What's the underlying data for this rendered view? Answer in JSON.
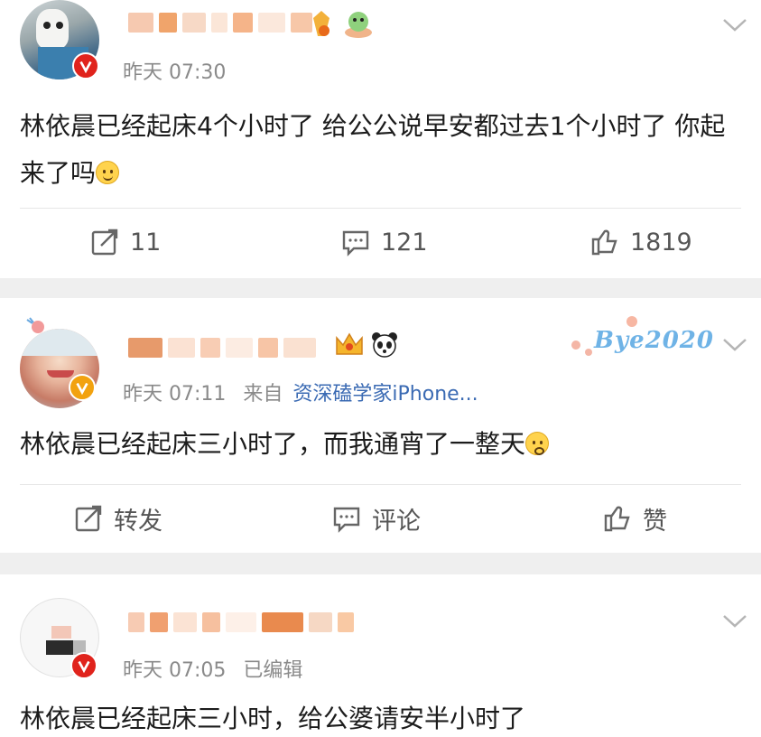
{
  "posts": [
    {
      "time": "昨天 07:30",
      "source_prefix": "",
      "source": "",
      "text": "林依晨已经起床4个小时了 给公公说早安都过去1个小时了 你起来了吗",
      "actions": {
        "repost": "11",
        "comment": "121",
        "like": "1819"
      }
    },
    {
      "time": "昨天 07:11",
      "source_prefix": "来自",
      "source": "资深磕学家iPhone...",
      "text": "林依晨已经起床三小时了，而我通宵了一整天",
      "actions": {
        "repost": "转发",
        "comment": "评论",
        "like": "赞"
      },
      "sticker": "Bye2020"
    },
    {
      "time": "昨天 07:05",
      "source_prefix": "已编辑",
      "source": "",
      "text": "林依晨已经起床三小时，给公婆请安半小时了"
    }
  ],
  "icons": {
    "repost": "repost-icon",
    "comment": "comment-icon",
    "like": "thumbs-up-icon",
    "more": "chevron-down-icon",
    "verified": "verified-badge-icon"
  },
  "colors": {
    "source_link": "#3a6ab3",
    "badge_orange": "#f2a20f",
    "badge_red": "#e0231c",
    "meta_gray": "#8a8a8a"
  }
}
